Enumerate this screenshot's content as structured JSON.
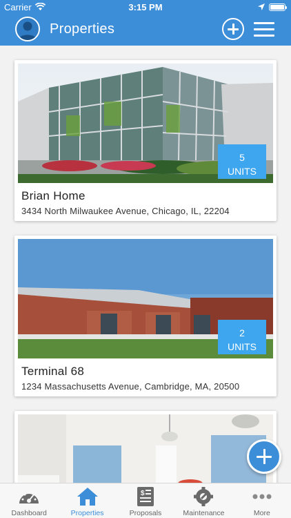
{
  "status_bar": {
    "carrier": "Carrier",
    "time": "3:15 PM"
  },
  "nav": {
    "title": "Properties"
  },
  "properties": [
    {
      "name": "Brian Home",
      "address": "3434 North Milwaukee Avenue, Chicago, IL, 22204",
      "units_count": "5",
      "units_label": "UNITS"
    },
    {
      "name": "Terminal 68",
      "address": "1234 Massachusetts Avenue, Cambridge, MA, 20500",
      "units_count": "2",
      "units_label": "UNITS"
    }
  ],
  "tabs": [
    {
      "label": "Dashboard",
      "icon": "gauge-icon",
      "active": false
    },
    {
      "label": "Properties",
      "icon": "house-icon",
      "active": true
    },
    {
      "label": "Proposals",
      "icon": "invoice-icon",
      "active": false
    },
    {
      "label": "Maintenance",
      "icon": "gear-wrench-icon",
      "active": false
    },
    {
      "label": "More",
      "icon": "more-dots-icon",
      "active": false
    }
  ],
  "colors": {
    "primary": "#3d8ed9",
    "badge": "#3da6ef",
    "background": "#f2f2f2",
    "inactive_tab": "#666666"
  }
}
